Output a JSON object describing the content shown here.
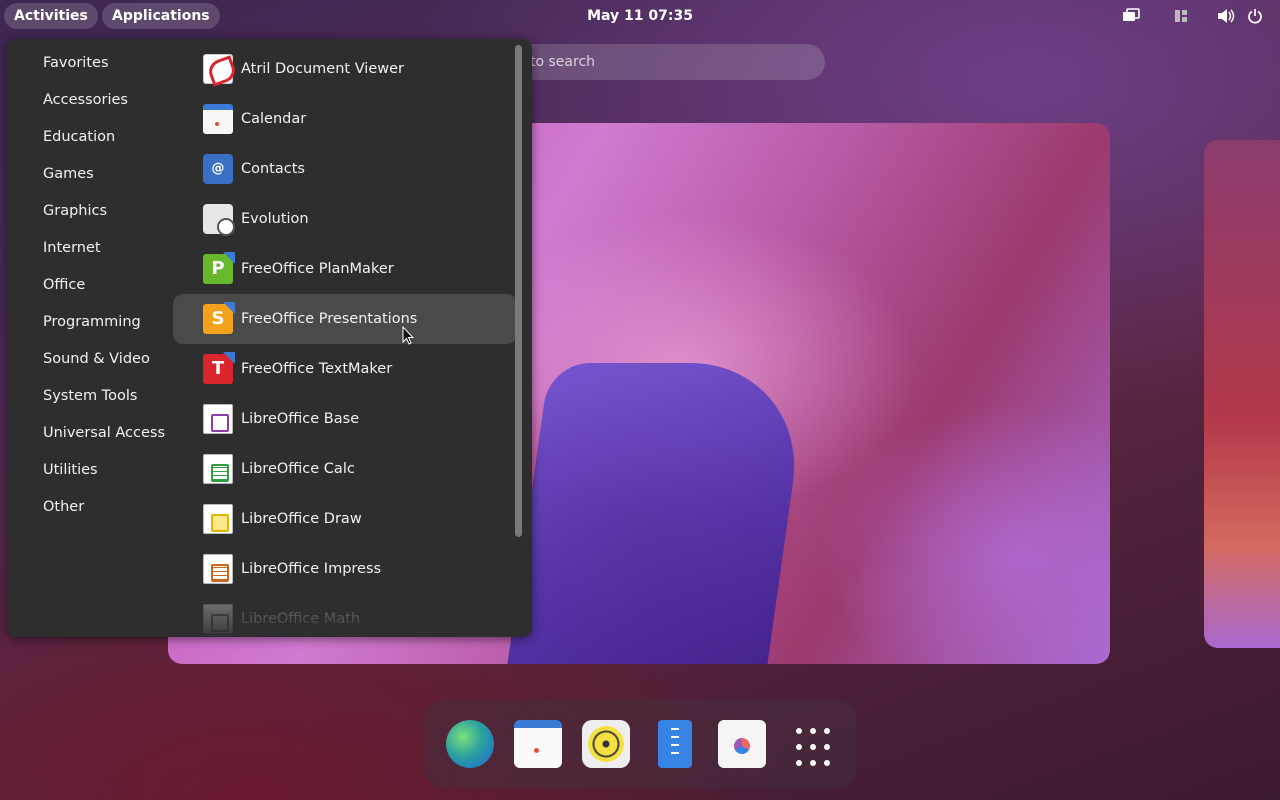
{
  "topbar": {
    "activities": "Activities",
    "applications": "Applications",
    "clock": "May 11  07:35",
    "tray_icons": [
      "screen-share-icon",
      "window-layout-icon",
      "volume-icon",
      "power-icon"
    ]
  },
  "overview": {
    "search_placeholder": "to search"
  },
  "menu": {
    "categories": [
      "Favorites",
      "Accessories",
      "Education",
      "Games",
      "Graphics",
      "Internet",
      "Office",
      "Programming",
      "Sound & Video",
      "System Tools",
      "Universal Access",
      "Utilities",
      "Other"
    ],
    "apps": [
      {
        "label": "Atril Document Viewer",
        "icon": "atril-icon"
      },
      {
        "label": "Calendar",
        "icon": "calendar-icon"
      },
      {
        "label": "Contacts",
        "icon": "contacts-icon",
        "glyph": "@"
      },
      {
        "label": "Evolution",
        "icon": "evolution-icon"
      },
      {
        "label": "FreeOffice PlanMaker",
        "icon": "planmaker-icon",
        "glyph": "P"
      },
      {
        "label": "FreeOffice Presentations",
        "icon": "presentations-icon",
        "glyph": "S"
      },
      {
        "label": "FreeOffice TextMaker",
        "icon": "textmaker-icon",
        "glyph": "T"
      },
      {
        "label": "LibreOffice Base",
        "icon": "libreoffice-base-icon"
      },
      {
        "label": "LibreOffice Calc",
        "icon": "libreoffice-calc-icon"
      },
      {
        "label": "LibreOffice Draw",
        "icon": "libreoffice-draw-icon"
      },
      {
        "label": "LibreOffice Impress",
        "icon": "libreoffice-impress-icon"
      },
      {
        "label": "LibreOffice Math",
        "icon": "libreoffice-math-icon"
      }
    ],
    "hovered_app": "FreeOffice Presentations"
  },
  "dock": {
    "items": [
      "browser-icon",
      "calendar-icon",
      "rhythmbox-icon",
      "files-icon",
      "software-store-icon",
      "show-apps-icon"
    ]
  }
}
